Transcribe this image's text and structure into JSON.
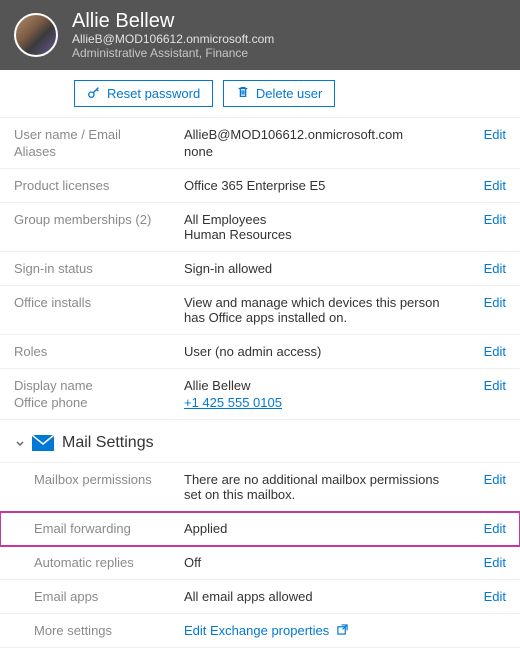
{
  "header": {
    "display_name": "Allie Bellew",
    "email": "AllieB@MOD106612.onmicrosoft.com",
    "title": "Administrative Assistant, Finance"
  },
  "actions": {
    "reset_password": "Reset password",
    "delete_user": "Delete user"
  },
  "labels": {
    "username_email": "User name / Email",
    "aliases": "Aliases",
    "product_licenses": "Product licenses",
    "group_memberships": "Group memberships (2)",
    "signin_status": "Sign-in status",
    "office_installs": "Office installs",
    "roles": "Roles",
    "display_name": "Display name",
    "office_phone": "Office phone",
    "mail_settings": "Mail Settings",
    "mailbox_permissions": "Mailbox permissions",
    "email_forwarding": "Email forwarding",
    "automatic_replies": "Automatic replies",
    "email_apps": "Email apps",
    "more_settings": "More settings",
    "edit": "Edit",
    "edit_exchange": "Edit Exchange properties"
  },
  "values": {
    "username_email": "AllieB@MOD106612.onmicrosoft.com",
    "aliases": "none",
    "product_licenses": "Office 365 Enterprise E5",
    "group1": "All Employees",
    "group2": "Human Resources",
    "signin_status": "Sign-in allowed",
    "office_installs": "View and manage which devices this person has Office apps installed on.",
    "roles": "User (no admin access)",
    "display_name": "Allie Bellew",
    "office_phone": "+1 425 555 0105",
    "mailbox_permissions": "There are no additional mailbox permissions set on this mailbox.",
    "email_forwarding": "Applied",
    "automatic_replies": "Off",
    "email_apps": "All email apps allowed"
  }
}
